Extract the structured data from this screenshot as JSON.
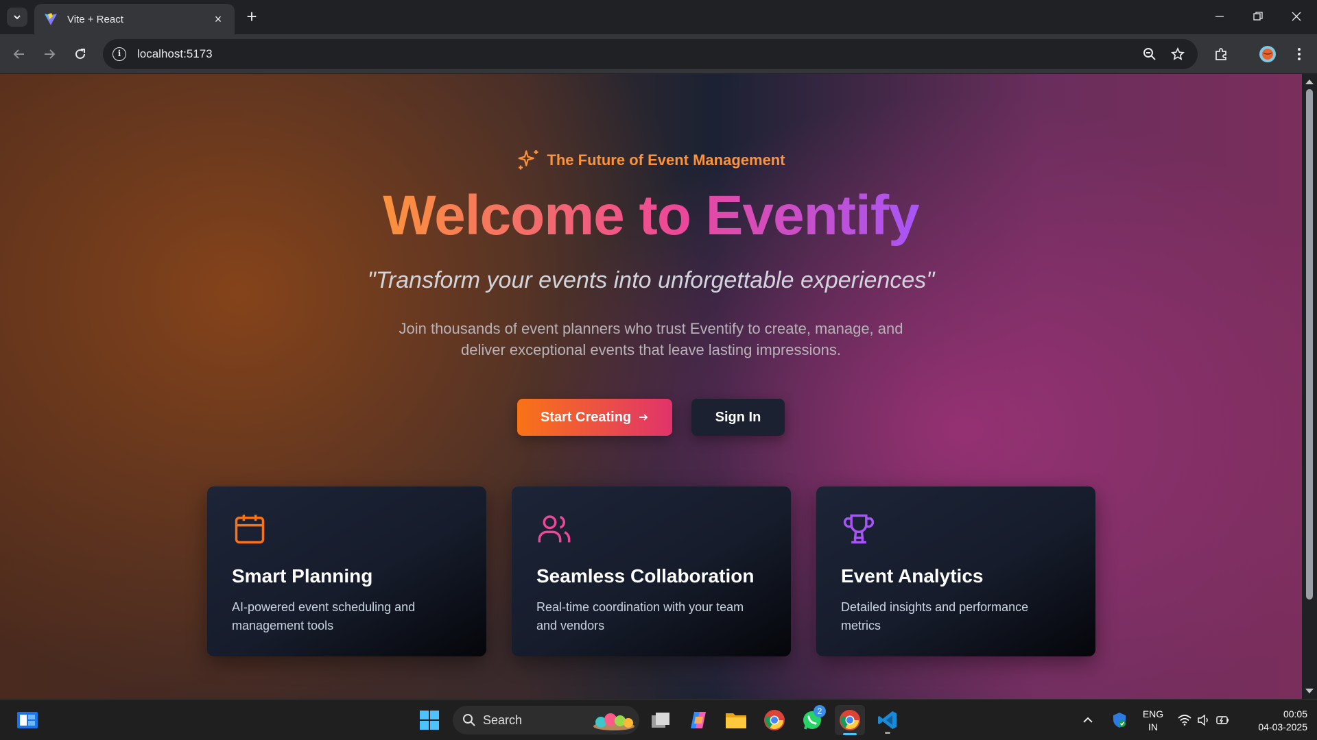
{
  "browser": {
    "tab_title": "Vite + React",
    "url": "localhost:5173",
    "new_tab": "+",
    "close_tab": "×"
  },
  "hero": {
    "tagline": "The Future of Event Management",
    "title": "Welcome to Eventify",
    "quote": "\"Transform your events into unforgettable experiences\"",
    "description": "Join thousands of event planners who trust Eventify to create, manage, and deliver exceptional events that leave lasting impressions."
  },
  "actions": {
    "primary_label": "Start Creating",
    "secondary_label": "Sign In"
  },
  "features": [
    {
      "title": "Smart Planning",
      "description": "AI-powered event scheduling and management tools",
      "icon": "calendar-icon",
      "color": "#f97316"
    },
    {
      "title": "Seamless Collaboration",
      "description": "Real-time coordination with your team and vendors",
      "icon": "users-icon",
      "color": "#ec4899"
    },
    {
      "title": "Event Analytics",
      "description": "Detailed insights and performance metrics",
      "icon": "trophy-icon",
      "color": "#a855f7"
    }
  ],
  "colors": {
    "accent_orange": "#fb923c",
    "accent_pink": "#ec4899",
    "accent_purple": "#a855f7"
  },
  "taskbar": {
    "search_label": "Search",
    "whatsapp_badge": "2",
    "language": "ENG",
    "region": "IN",
    "time": "00:05",
    "date": "04-03-2025"
  }
}
